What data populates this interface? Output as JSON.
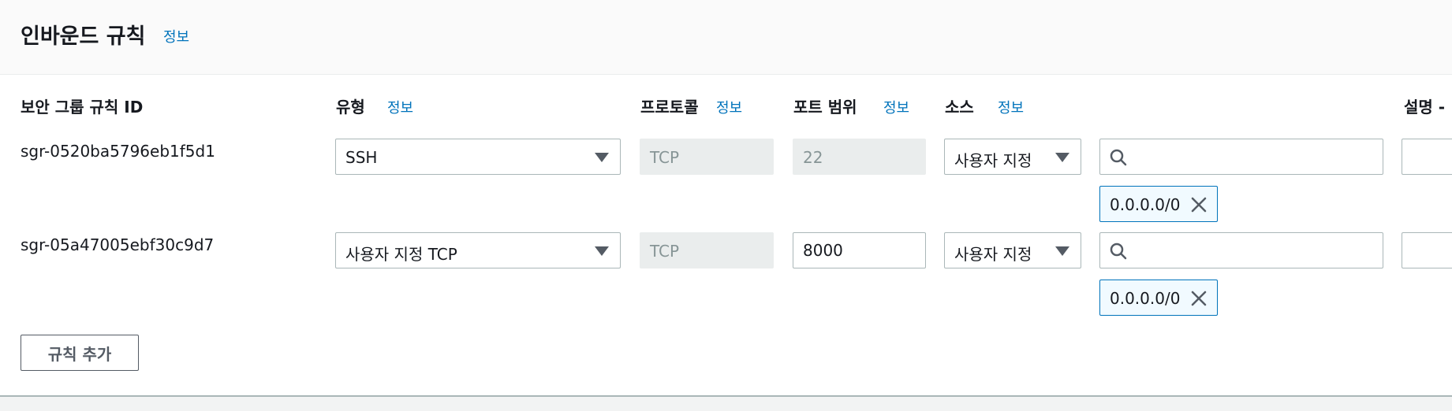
{
  "section": {
    "title": "인바운드 규칙",
    "info": "정보"
  },
  "columns": {
    "rule_id": "보안 그룹 규칙 ID",
    "type": "유형",
    "type_info": "정보",
    "protocol": "프로토콜",
    "protocol_info": "정보",
    "port_range": "포트 범위",
    "port_info": "정보",
    "source": "소스",
    "source_info": "정보",
    "description": "설명 -"
  },
  "rules": [
    {
      "id": "sgr-0520ba5796eb1f5d1",
      "type": "SSH",
      "protocol": "TCP",
      "port": "22",
      "source_type": "사용자 지정",
      "search_value": "",
      "cidr": "0.0.0.0/0",
      "description": ""
    },
    {
      "id": "sgr-05a47005ebf30c9d7",
      "type": "사용자 지정 TCP",
      "protocol": "TCP",
      "port": "8000",
      "source_type": "사용자 지정",
      "search_value": "",
      "cidr": "0.0.0.0/0",
      "description": ""
    }
  ],
  "add_rule_label": "규칙 추가",
  "colors": {
    "link": "#0073bb",
    "border": "#aab7b8",
    "disabled_bg": "#eaeded",
    "token_bg": "#f1faff"
  }
}
